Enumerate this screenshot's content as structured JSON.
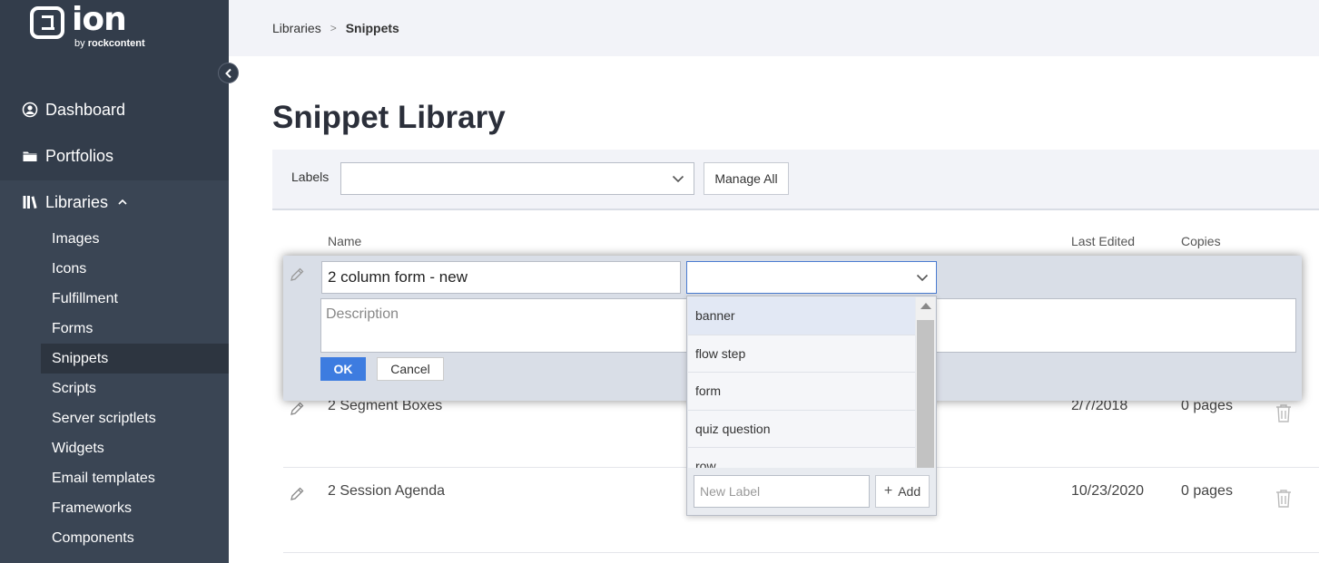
{
  "brand": {
    "name": "ion",
    "by": "by",
    "company": "rockcontent"
  },
  "sidebar": {
    "nav": [
      {
        "label": "Dashboard",
        "icon": "user-circle-icon"
      },
      {
        "label": "Portfolios",
        "icon": "folder-icon"
      },
      {
        "label": "Libraries",
        "icon": "books-icon"
      }
    ],
    "sub_items": [
      {
        "label": "Images"
      },
      {
        "label": "Icons"
      },
      {
        "label": "Fulfillment"
      },
      {
        "label": "Forms"
      },
      {
        "label": "Snippets",
        "active": true
      },
      {
        "label": "Scripts"
      },
      {
        "label": "Server scriptlets"
      },
      {
        "label": "Widgets"
      },
      {
        "label": "Email templates"
      },
      {
        "label": "Frameworks"
      },
      {
        "label": "Components"
      }
    ]
  },
  "breadcrumb": {
    "parent": "Libraries",
    "separator": ">",
    "current": "Snippets"
  },
  "page": {
    "title": "Snippet Library"
  },
  "filter": {
    "label": "Labels",
    "manage_button": "Manage All"
  },
  "table": {
    "columns": {
      "name": "Name",
      "last_edited": "Last Edited",
      "copies": "Copies"
    },
    "rows": [
      {
        "name": "2 Segment Boxes",
        "last_edited": "2/7/2018",
        "copies": "0 pages"
      },
      {
        "name": "2 Session Agenda",
        "last_edited": "10/23/2020",
        "copies": "0 pages"
      }
    ]
  },
  "edit": {
    "name_value": "2 column form - new",
    "description_placeholder": "Description",
    "ok_label": "OK",
    "cancel_label": "Cancel"
  },
  "label_dropdown": {
    "options": [
      "banner",
      "flow step",
      "form",
      "quiz question",
      "row"
    ],
    "new_label_placeholder": "New Label",
    "add_label": "Add"
  },
  "colors": {
    "sidebar_bg": "#333d4b",
    "accent": "#3d7ce0"
  }
}
